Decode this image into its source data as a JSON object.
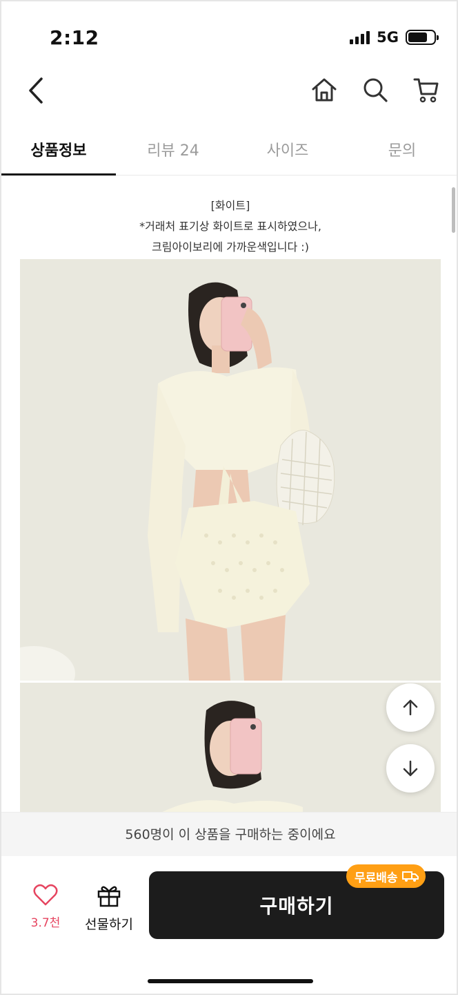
{
  "status_bar": {
    "time": "2:12",
    "network": "5G"
  },
  "nav": {
    "back_icon": "chevron-left-icon",
    "icons": [
      "home-icon",
      "search-icon",
      "cart-icon"
    ]
  },
  "tabs": [
    {
      "label": "상품정보",
      "active": true
    },
    {
      "label": "리뷰 24",
      "active": false
    },
    {
      "label": "사이즈",
      "active": false
    },
    {
      "label": "문의",
      "active": false
    }
  ],
  "notice": {
    "line1": "[화이트]",
    "line2": "*거래처 표기상 화이트로 표시하였으나,",
    "line3": "크림아이보리에 가까운색입니다 :)"
  },
  "fab": {
    "up_icon": "arrow-up-icon",
    "down_icon": "arrow-down-icon"
  },
  "banner": {
    "text": "560명이 이 상품을 구매하는 중이에요"
  },
  "bottom_bar": {
    "like_count": "3.7천",
    "gift_label": "선물하기",
    "buy_label": "구매하기",
    "free_shipping_label": "무료배송"
  },
  "colors": {
    "accent": "#ff9f14",
    "like": "#e64560",
    "buy_bg": "#1c1c1c"
  }
}
